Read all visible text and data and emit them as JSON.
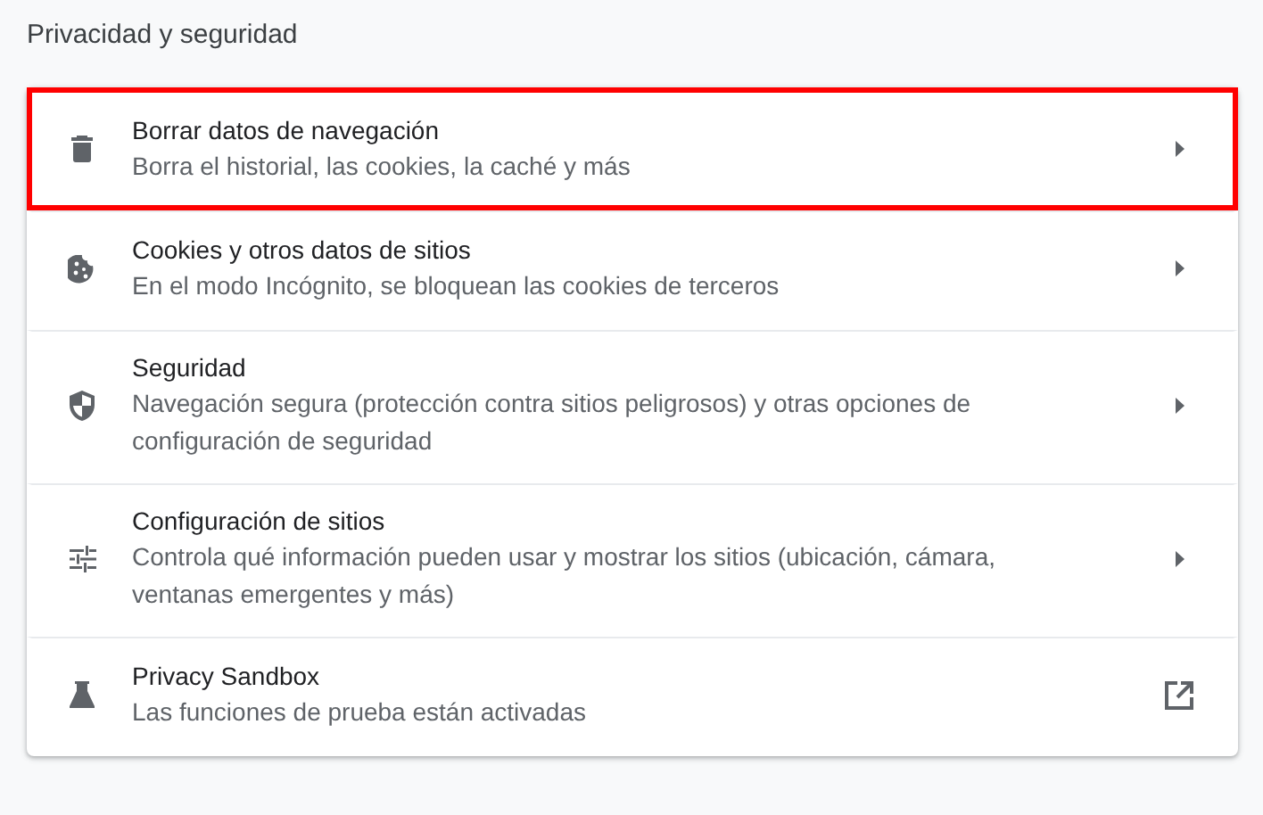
{
  "section_title": "Privacidad y seguridad",
  "items": [
    {
      "kind": "subpage",
      "title": "Borrar datos de navegación",
      "subtitle": "Borra el historial, las cookies, la caché y más",
      "highlighted": true
    },
    {
      "kind": "subpage",
      "title": "Cookies y otros datos de sitios",
      "subtitle": "En el modo Incógnito, se bloquean las cookies de terceros",
      "highlighted": false
    },
    {
      "kind": "subpage",
      "title": "Seguridad",
      "subtitle": "Navegación segura (protección contra sitios peligrosos) y otras opciones de configuración de seguridad",
      "highlighted": false
    },
    {
      "kind": "subpage",
      "title": "Configuración de sitios",
      "subtitle": "Controla qué información pueden usar y mostrar los sitios (ubicación, cámara, ventanas emergentes y más)",
      "highlighted": false
    },
    {
      "kind": "external",
      "title": "Privacy Sandbox",
      "subtitle": "Las funciones de prueba están activadas",
      "highlighted": false
    }
  ]
}
